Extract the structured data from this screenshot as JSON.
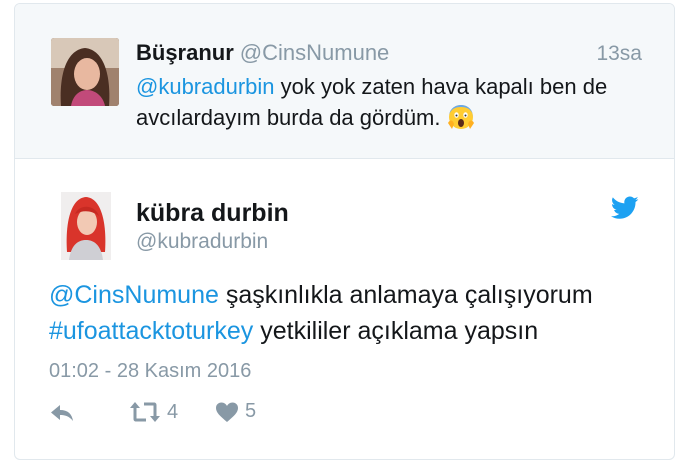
{
  "parent_tweet": {
    "display_name": "Büşranur",
    "handle": "@CinsNumune",
    "time": "13sa",
    "mention": "@kubradurbin",
    "text": " yok yok zaten hava kapalı ben de avcılardayım burda da gördüm.",
    "emoji_icon": "face-screaming-in-fear-icon"
  },
  "main_tweet": {
    "display_name": "kübra durbin",
    "handle": "@kubradurbin",
    "mention": "@CinsNumune",
    "text_part1": " şaşkınlıkla anlamaya çalışıyorum ",
    "hashtag": "#ufoattacktoturkey",
    "text_part2": " yetkililer açıklama yapsın",
    "timestamp": "01:02 - 28 Kasım 2016",
    "retweet_count": "4",
    "like_count": "5",
    "brand_icon": "twitter-bird-icon"
  },
  "colors": {
    "link": "#1b95e0",
    "muted": "#8899a6",
    "text": "#14171a",
    "parent_bg": "#f5f8fa",
    "twitter_blue": "#1da1f2"
  }
}
